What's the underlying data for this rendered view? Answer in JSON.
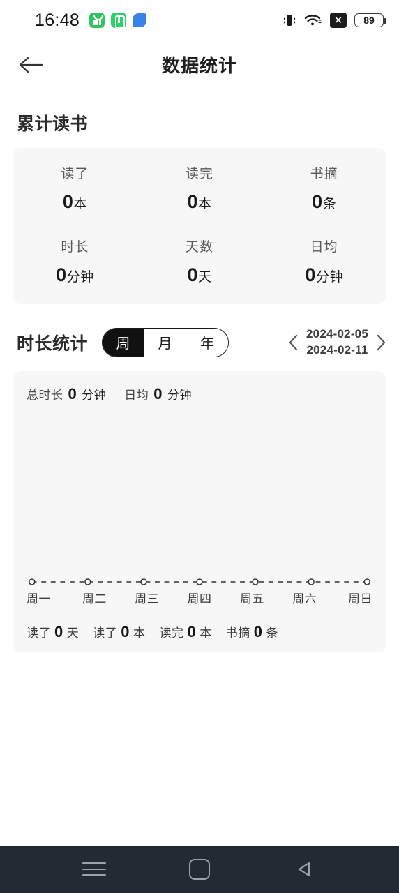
{
  "status_bar": {
    "time": "16:48",
    "app_icons": [
      "app-icon-green-headphones",
      "app-icon-green-battery",
      "app-icon-blue-leaf"
    ],
    "right_icons": [
      "vibrate-icon",
      "wifi-icon",
      "no-sim-icon"
    ],
    "battery_level": "89"
  },
  "app_bar": {
    "back_icon": "back-arrow-icon",
    "title": "数据统计"
  },
  "cumulative": {
    "section_title": "累计读书",
    "row1": [
      {
        "label": "读了",
        "value": "0",
        "unit": "本"
      },
      {
        "label": "读完",
        "value": "0",
        "unit": "本"
      },
      {
        "label": "书摘",
        "value": "0",
        "unit": "条"
      }
    ],
    "row2": [
      {
        "label": "时长",
        "value": "0",
        "unit": "分钟"
      },
      {
        "label": "天数",
        "value": "0",
        "unit": "天"
      },
      {
        "label": "日均",
        "value": "0",
        "unit": "分钟"
      }
    ]
  },
  "duration": {
    "section_title": "时长统计",
    "tabs": [
      {
        "label": "周",
        "active": true
      },
      {
        "label": "月",
        "active": false
      },
      {
        "label": "年",
        "active": false
      }
    ],
    "range": {
      "prev_icon": "chevron-left-icon",
      "next_icon": "chevron-right-icon",
      "start_date": "2024-02-05",
      "end_date": "2024-02-11"
    },
    "summary": [
      {
        "label": "总时长",
        "value": "0",
        "unit": "分钟"
      },
      {
        "label": "日均",
        "value": "0",
        "unit": "分钟"
      }
    ],
    "footer": [
      {
        "label": "读了",
        "value": "0",
        "unit": "天"
      },
      {
        "label": "读了",
        "value": "0",
        "unit": "本"
      },
      {
        "label": "读完",
        "value": "0",
        "unit": "本"
      },
      {
        "label": "书摘",
        "value": "0",
        "unit": "条"
      }
    ]
  },
  "chart_data": {
    "type": "line",
    "title": "时长统计",
    "categories": [
      "周一",
      "周二",
      "周三",
      "周四",
      "周五",
      "周六",
      "周日"
    ],
    "values": [
      0,
      0,
      0,
      0,
      0,
      0,
      0
    ],
    "ylabel": "分钟",
    "xlabel": "",
    "ylim": [
      0,
      0
    ],
    "grid": false,
    "legend": "none",
    "line_style": "dashed",
    "marker": "open-circle",
    "series_color": "#333333"
  },
  "nav_bar": {
    "items": [
      "recents-icon",
      "home-icon",
      "back-icon"
    ]
  }
}
